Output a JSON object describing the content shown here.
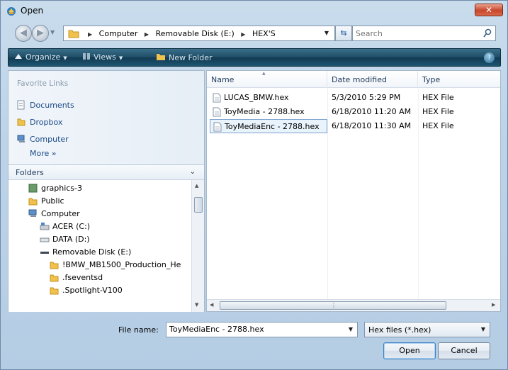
{
  "window": {
    "title": "Open",
    "close_label": "✕"
  },
  "address": {
    "crumbs": [
      "Computer",
      "Removable Disk (E:)",
      "HEX'S"
    ],
    "search_placeholder": "Search"
  },
  "toolbar": {
    "organize": "Organize",
    "views": "Views",
    "new_folder": "New Folder"
  },
  "favorite_links": {
    "title": "Favorite Links",
    "items": [
      "Documents",
      "Dropbox",
      "Computer"
    ],
    "more": "More »"
  },
  "folders": {
    "title": "Folders",
    "tree": [
      "graphics-3",
      "Public",
      "Computer",
      "ACER (C:)",
      "DATA (D:)",
      "Removable Disk (E:)",
      "!BMW_MB1500_Production_He",
      ".fseventsd",
      ".Spotlight-V100"
    ]
  },
  "file_list": {
    "columns": [
      "Name",
      "Date modified",
      "Type"
    ],
    "rows": [
      {
        "name": "LUCAS_BMW.hex",
        "date": "5/3/2010 5:29 PM",
        "type": "HEX File"
      },
      {
        "name": "ToyMedia - 2788.hex",
        "date": "6/18/2010 11:20 AM",
        "type": "HEX File"
      },
      {
        "name": "ToyMediaEnc - 2788.hex",
        "date": "6/18/2010 11:30 AM",
        "type": "HEX File"
      }
    ],
    "selected_index": 2
  },
  "bottom": {
    "file_name_label": "File name:",
    "file_name_value": "ToyMediaEnc - 2788.hex",
    "file_type": "Hex files (*.hex)",
    "open_label": "Open",
    "cancel_label": "Cancel"
  },
  "colors": {
    "toolbar": "#1e4c66",
    "link": "#1c4a87",
    "selection_border": "#7da2ce"
  }
}
